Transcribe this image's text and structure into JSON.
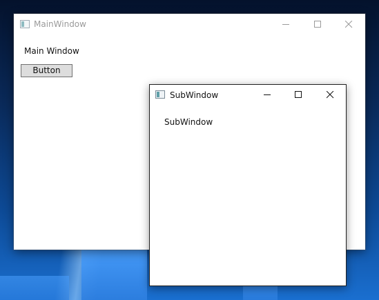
{
  "main_window": {
    "title": "MainWindow",
    "label": "Main Window",
    "button_label": "Button"
  },
  "sub_window": {
    "title": "SubWindow",
    "label": "SubWindow"
  },
  "icons": {
    "app": "app-window-icon",
    "minimize": "minimize-icon",
    "maximize": "maximize-icon",
    "close": "close-icon"
  }
}
